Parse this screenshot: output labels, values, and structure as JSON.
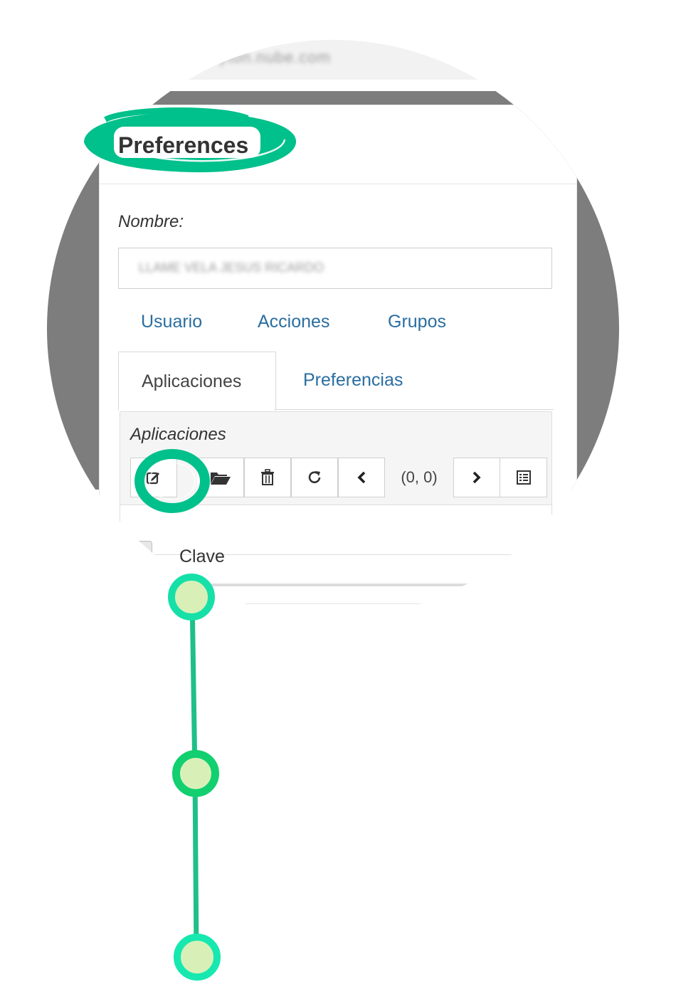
{
  "panel": {
    "title": "Preferences",
    "name_label": "Nombre:",
    "name_value": "LLAME VELA JESUS RICARDO"
  },
  "tabs_row1": [
    "Usuario",
    "Acciones",
    "Grupos"
  ],
  "tabs_row2": {
    "active": "Aplicaciones",
    "other": "Preferencias"
  },
  "subpanel": {
    "title": "Aplicaciones",
    "counter": "(0, 0)",
    "toolbar_icons": [
      "edit-icon",
      "folder-open-icon",
      "trash-icon",
      "refresh-icon",
      "chevron-left-icon",
      "chevron-right-icon",
      "list-icon"
    ]
  },
  "table": {
    "column_label": "Clave"
  },
  "top_bar_text": "demo.tryton.nube.com",
  "colors": {
    "accent_green": "#00c08b",
    "node_fill": "#d8f0b8",
    "link_blue": "#2a6ea0",
    "lens_gray": "#7d7d7d"
  }
}
